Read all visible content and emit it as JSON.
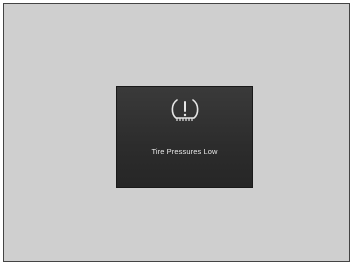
{
  "warning": {
    "icon": "tire-pressure-warning-icon",
    "message": "Tire Pressures Low",
    "colors": {
      "background": "#cfcfcf",
      "display": "#2e2e2e",
      "foreground": "#e8e8e8"
    }
  }
}
